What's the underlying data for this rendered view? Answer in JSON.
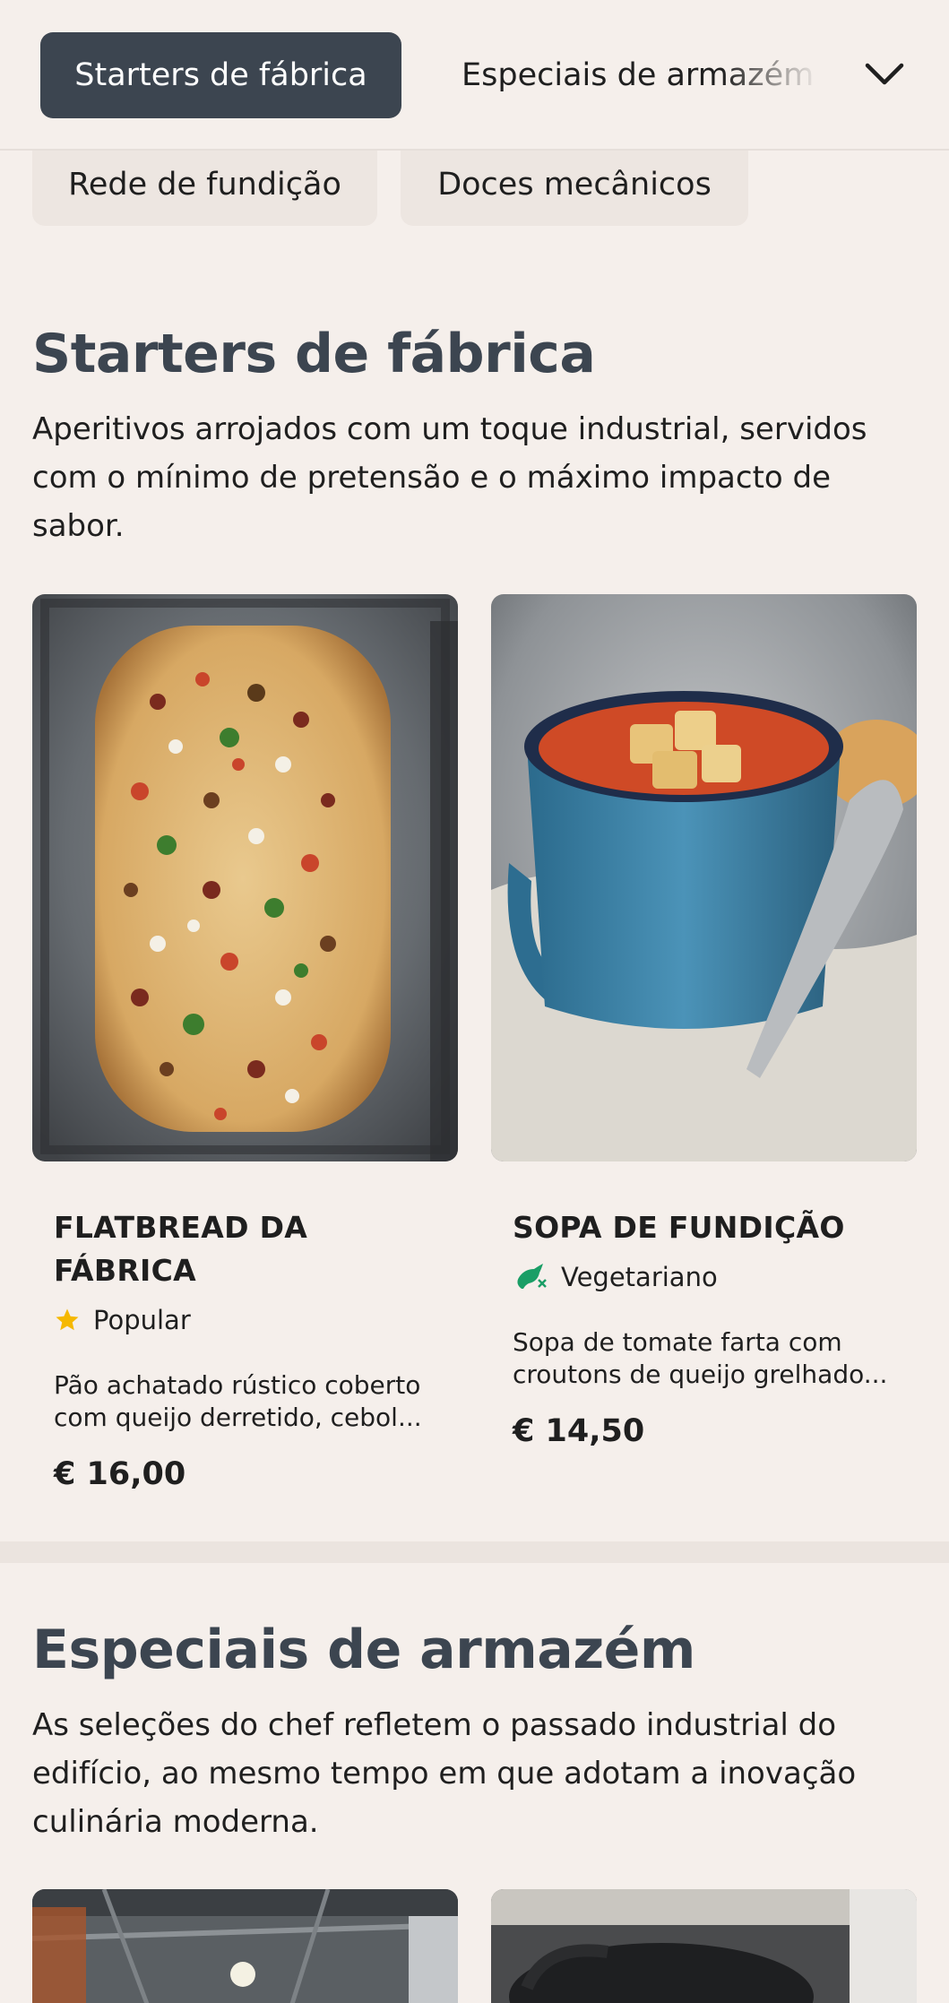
{
  "nav": {
    "active_tab": "Starters de fábrica",
    "next_tab": "Especiais de armazém",
    "more_icon": "chevron-down-icon",
    "chips": [
      "Rede de fundição",
      "Doces mecânicos"
    ]
  },
  "sections": [
    {
      "title": "Starters de fábrica",
      "description": "Aperitivos arrojados com um toque industrial, servidos com o mínimo de pretensão e o máximo impacto de sabor.",
      "items": [
        {
          "name": "FLATBREAD DA FÁBRICA",
          "tag": "Popular",
          "tag_icon": "star-icon",
          "description": "Pão achatado rústico coberto com queijo derretido, cebol...",
          "price": "€ 16,00"
        },
        {
          "name": "SOPA DE FUNDIÇÃO",
          "tag": "Vegetariano",
          "tag_icon": "vegetarian-icon",
          "description": "Sopa de tomate farta com croutons de queijo grelhado...",
          "price": "€ 14,50"
        }
      ]
    },
    {
      "title": "Especiais de armazém",
      "description": "As seleções do chef refletem o passado industrial do edifício, ao mesmo tempo em que adotam a inovação culinária moderna."
    }
  ],
  "colors": {
    "background": "#f5efeb",
    "active_tab": "#3c4550",
    "heading": "#3c4550",
    "star": "#f5b800",
    "vegetarian": "#1a9e66"
  }
}
